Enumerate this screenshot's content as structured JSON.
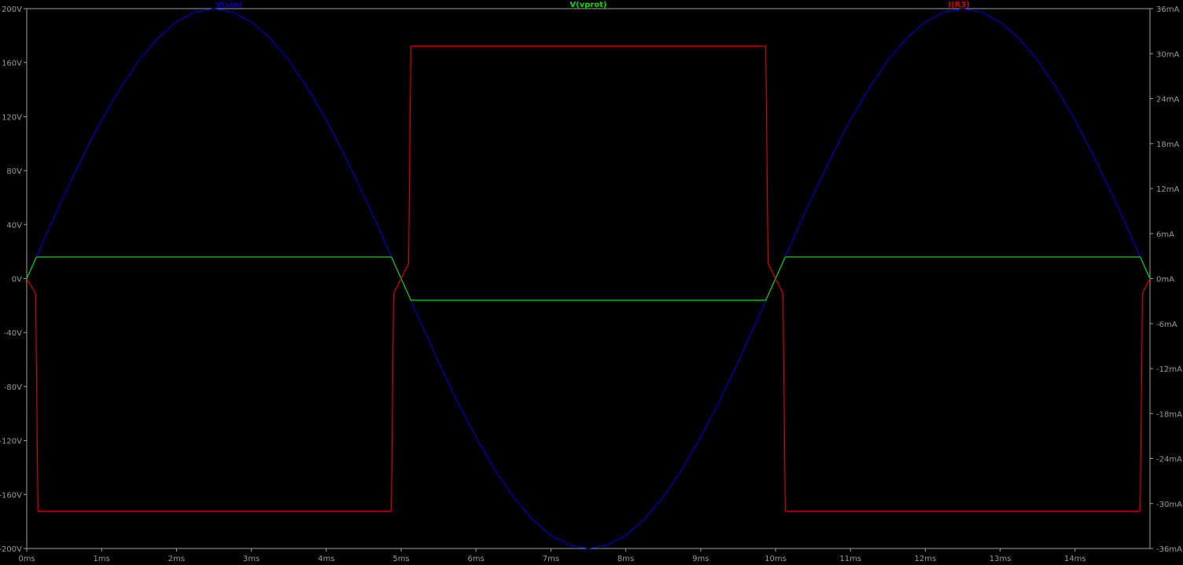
{
  "chart_data": {
    "type": "line",
    "background": "#000000",
    "axis_color": "#a0a0a0",
    "x": {
      "range": [
        0,
        15
      ],
      "unit": "ms",
      "ticks": [
        0,
        1,
        2,
        3,
        4,
        5,
        6,
        7,
        8,
        9,
        10,
        11,
        12,
        13,
        14
      ],
      "tick_labels": [
        "0ms",
        "1ms",
        "2ms",
        "3ms",
        "4ms",
        "5ms",
        "6ms",
        "7ms",
        "8ms",
        "9ms",
        "10ms",
        "11ms",
        "12ms",
        "13ms",
        "14ms"
      ]
    },
    "y_left": {
      "range": [
        -200,
        200
      ],
      "unit": "V",
      "ticks": [
        200,
        160,
        120,
        80,
        40,
        0,
        -40,
        -80,
        -120,
        -160,
        -200
      ],
      "tick_labels": [
        "200V",
        "160V",
        "120V",
        "80V",
        "40V",
        "0V",
        "-40V",
        "-80V",
        "-120V",
        "-160V",
        "-200V"
      ]
    },
    "y_right": {
      "range": [
        -36,
        36
      ],
      "unit": "mA",
      "ticks": [
        36,
        30,
        24,
        18,
        12,
        6,
        0,
        -6,
        -12,
        -18,
        -24,
        -30,
        -36
      ],
      "tick_labels": [
        "36mA",
        "30mA",
        "24mA",
        "18mA",
        "12mA",
        "6mA",
        "0mA",
        "-6mA",
        "-12mA",
        "-18mA",
        "-24mA",
        "-30mA",
        "-36mA"
      ]
    },
    "series": [
      {
        "name": "V(vin)",
        "color": "#0000c8",
        "axis": "left",
        "x": [
          0,
          0.25,
          0.5,
          0.75,
          1,
          1.25,
          1.5,
          1.75,
          2,
          2.25,
          2.5,
          2.75,
          3,
          3.25,
          3.5,
          3.75,
          4,
          4.25,
          4.5,
          4.75,
          5,
          5.25,
          5.5,
          5.75,
          6,
          6.25,
          6.5,
          6.75,
          7,
          7.25,
          7.5,
          7.75,
          8,
          8.25,
          8.5,
          8.75,
          9,
          9.25,
          9.5,
          9.75,
          10,
          10.25,
          10.5,
          10.75,
          11,
          11.25,
          11.5,
          11.75,
          12,
          12.25,
          12.5,
          12.75,
          13,
          13.25,
          13.5,
          13.75,
          14,
          14.25,
          14.5,
          14.75,
          15
        ],
        "y": [
          0,
          31.3,
          61.8,
          90.8,
          117.6,
          141.4,
          161.8,
          178.2,
          190.2,
          197.5,
          200,
          197.5,
          190.2,
          178.2,
          161.8,
          141.4,
          117.6,
          90.8,
          61.8,
          31.3,
          0,
          -31.3,
          -61.8,
          -90.8,
          -117.6,
          -141.4,
          -161.8,
          -178.2,
          -190.2,
          -197.5,
          -200,
          -197.5,
          -190.2,
          -178.2,
          -161.8,
          -141.4,
          -117.6,
          -90.8,
          -61.8,
          -31.3,
          0,
          31.3,
          61.8,
          90.8,
          117.6,
          141.4,
          161.8,
          178.2,
          190.2,
          197.5,
          200,
          197.5,
          190.2,
          178.2,
          161.8,
          141.4,
          117.6,
          90.8,
          61.8,
          31.3,
          0
        ]
      },
      {
        "name": "V(vprot)",
        "color": "#00dc00",
        "axis": "left",
        "x": [
          0,
          0.13,
          4.87,
          5.13,
          9.87,
          10.13,
          14.87,
          15
        ],
        "y": [
          0,
          16,
          16,
          -16,
          -16,
          16,
          16,
          0
        ]
      },
      {
        "name": "I(R3)",
        "color": "#dc0000",
        "axis": "right",
        "x": [
          0,
          0.12,
          0.15,
          4.87,
          4.9,
          5.1,
          5.13,
          9.87,
          9.9,
          10.1,
          10.13,
          14.87,
          14.9,
          15
        ],
        "y": [
          0,
          -2,
          -31,
          -31,
          -2,
          2,
          31,
          31,
          2,
          -2,
          -31,
          -31,
          -2,
          0
        ]
      }
    ]
  }
}
